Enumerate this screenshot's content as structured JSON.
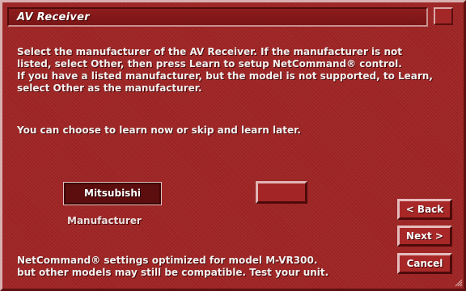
{
  "window": {
    "title": "AV Receiver"
  },
  "instructions": {
    "lines": [
      "Select the manufacturer of the AV Receiver. If the manufacturer is not",
      "listed, select Other, then press Learn to setup NetCommand® control.",
      "If you have a listed manufacturer, but the model is not supported, to Learn,",
      "select Other as the manufacturer."
    ],
    "choose_text": "You can choose to learn now or skip and learn later."
  },
  "manufacturer": {
    "selected_value": "Mitsubishi",
    "label": "Manufacturer"
  },
  "buttons": {
    "learn_label": "",
    "back_label": "< Back",
    "next_label": "Next >",
    "cancel_label": "Cancel"
  },
  "footer": {
    "lines": [
      "NetCommand® settings optimized for model M-VR300.",
      "but other models may still be compatible. Test your unit."
    ]
  },
  "colors": {
    "background": "#9f2424",
    "text": "#f4f0f0",
    "select_background": "#5c0d0d"
  },
  "icons": {
    "resize_grip": "resize-grip-icon"
  }
}
